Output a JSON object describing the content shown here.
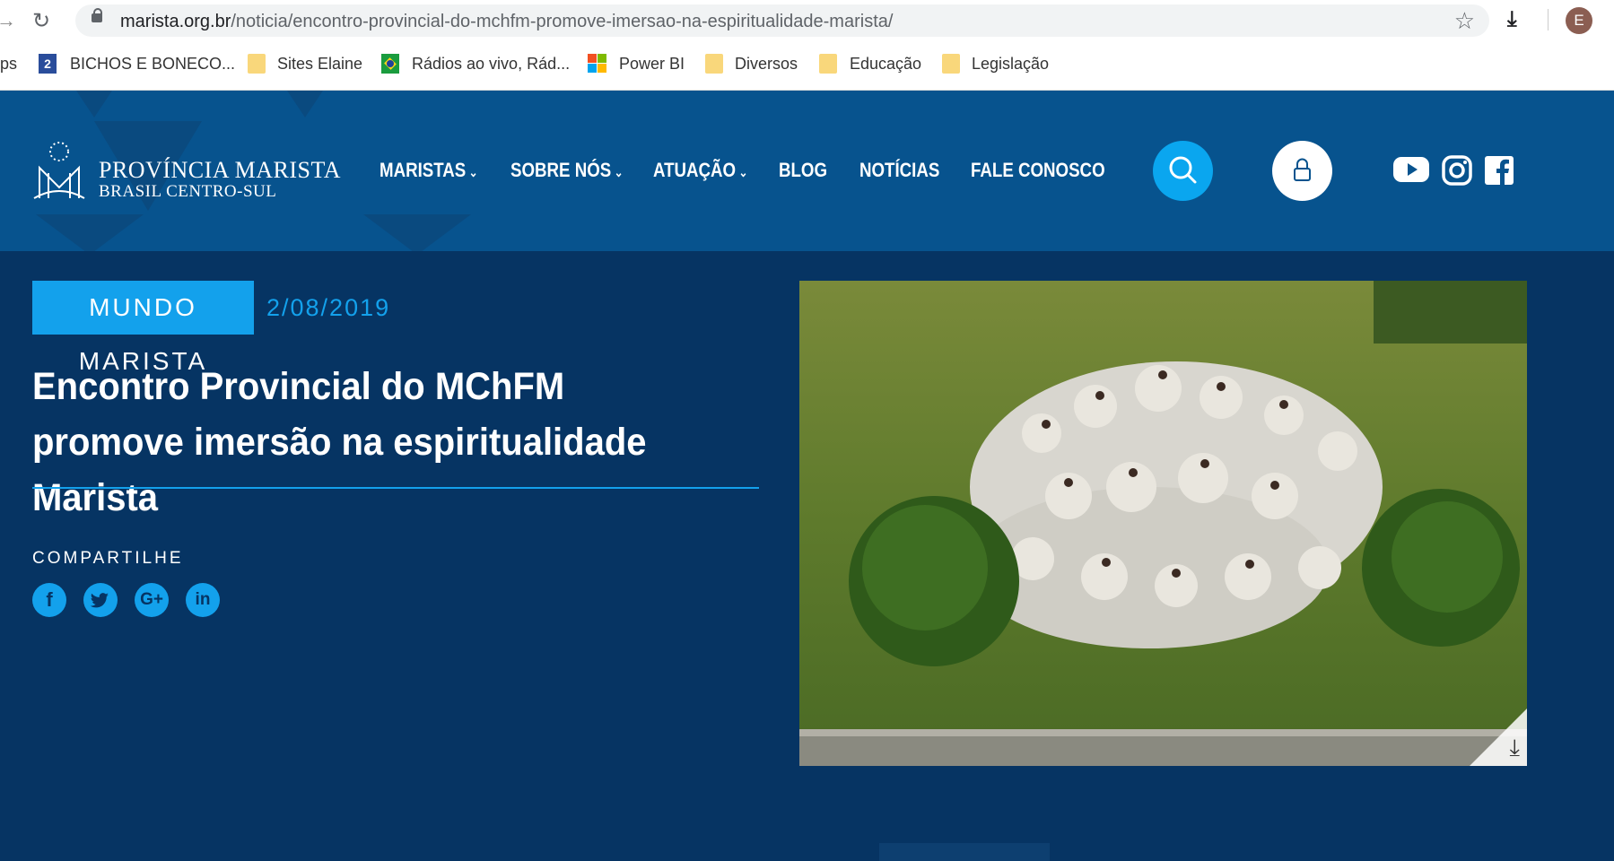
{
  "browser": {
    "url_domain": "marista.org.br",
    "url_path": "/noticia/encontro-provincial-do-mchfm-promove-imersao-na-espiritualidade-marista/",
    "profile_initial": "E"
  },
  "bookmarks": [
    {
      "label": "ps",
      "icon": "apps-icon"
    },
    {
      "label": "BICHOS E BONECO...",
      "icon": "site-icon"
    },
    {
      "label": "Sites Elaine",
      "icon": "folder-icon"
    },
    {
      "label": "Rádios ao vivo, Rád...",
      "icon": "brazil-flag-icon"
    },
    {
      "label": "Power BI",
      "icon": "microsoft-icon"
    },
    {
      "label": "Diversos",
      "icon": "folder-icon"
    },
    {
      "label": "Educação",
      "icon": "folder-icon"
    },
    {
      "label": "Legislação",
      "icon": "folder-icon"
    }
  ],
  "site": {
    "logo_line1": "PROVÍNCIA MARISTA",
    "logo_line2": "BRASIL CENTRO-SUL",
    "menu": [
      {
        "label": "MARISTAS",
        "dropdown": true
      },
      {
        "label": "SOBRE NÓS",
        "dropdown": true
      },
      {
        "label": "ATUAÇÃO",
        "dropdown": true
      },
      {
        "label": "BLOG",
        "dropdown": false
      },
      {
        "label": "NOTÍCIAS",
        "dropdown": false
      },
      {
        "label": "FALE CONOSCO",
        "dropdown": false
      }
    ],
    "colors": {
      "header": "#07538e",
      "main": "#063463",
      "accent": "#13a1ec"
    }
  },
  "article": {
    "category": "MUNDO MARISTA",
    "date": "2/08/2019",
    "title": "Encontro Provincial do MChFM promove imersão na espiritualidade Marista",
    "share_label": "COMPARTILHE",
    "share_icons": [
      "facebook-icon",
      "twitter-icon",
      "google-plus-icon",
      "linkedin-icon"
    ]
  }
}
